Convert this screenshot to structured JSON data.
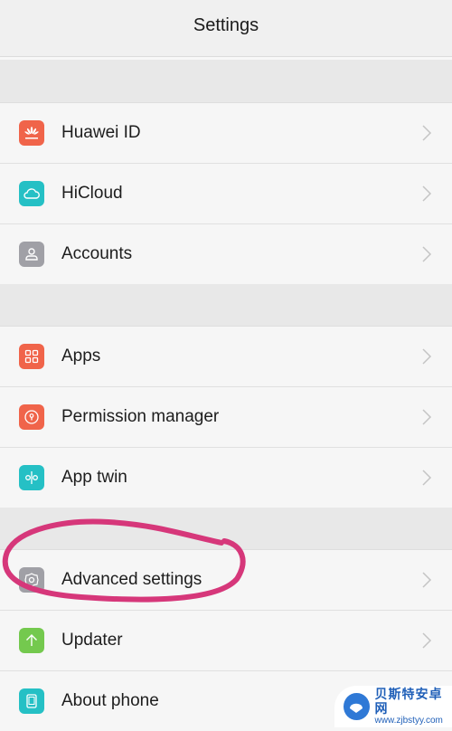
{
  "header": {
    "title": "Settings"
  },
  "groups": [
    {
      "items": [
        {
          "label": "Huawei ID",
          "icon": "huawei-logo-icon",
          "color": "#f0644a"
        },
        {
          "label": "HiCloud",
          "icon": "cloud-icon",
          "color": "#25c0c5"
        },
        {
          "label": "Accounts",
          "icon": "person-icon",
          "color": "#a0a0a6"
        }
      ]
    },
    {
      "items": [
        {
          "label": "Apps",
          "icon": "apps-grid-icon",
          "color": "#f0644a"
        },
        {
          "label": "Permission manager",
          "icon": "lock-icon",
          "color": "#f0644a"
        },
        {
          "label": "App twin",
          "icon": "app-twin-icon",
          "color": "#25c0c5"
        }
      ]
    },
    {
      "items": [
        {
          "label": "Advanced settings",
          "icon": "gear-icon",
          "color": "#a0a0a6"
        },
        {
          "label": "Updater",
          "icon": "arrow-up-icon",
          "color": "#74c94e"
        },
        {
          "label": "About phone",
          "icon": "phone-icon",
          "color": "#25c0c5"
        }
      ]
    }
  ],
  "annotation": {
    "color": "#d6377a",
    "target": "Advanced settings"
  },
  "watermark": {
    "title": "贝斯特安卓网",
    "url": "www.zjbstyy.com"
  }
}
